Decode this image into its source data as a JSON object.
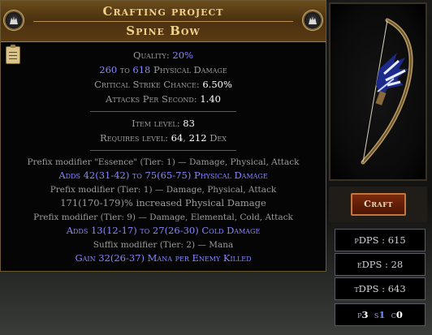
{
  "header": {
    "title": "Crafting project",
    "item_name": "Spine Bow"
  },
  "properties": {
    "quality_label": "Quality:",
    "quality_value": "20%",
    "damage_min": "260",
    "damage_to": "to",
    "damage_max": "618",
    "damage_label": "Physical Damage",
    "crit_label": "Critical Strike Chance:",
    "crit_value": "6.50%",
    "aps_label": "Attacks Per Second:",
    "aps_value": "1.40"
  },
  "requirements": {
    "item_level_label": "Item level:",
    "item_level_value": "83",
    "requires_label": "Requires level:",
    "requires_level": "64",
    "dex_value": "212",
    "dex_label": "Dex"
  },
  "modifiers": [
    {
      "header": "Prefix modifier \"Essence\" (Tier: 1) — Damage, Physical, Attack",
      "text": "Adds 42(31-42) to 75(65-75) Physical Damage",
      "color": "blue"
    },
    {
      "header": "Prefix modifier (Tier: 1) — Damage, Physical, Attack",
      "text": "171(170-179)% increased Physical Damage",
      "color": "grey"
    },
    {
      "header": "Prefix modifier (Tier: 9) — Damage, Elemental, Cold, Attack",
      "text": "Adds 13(12-17) to 27(26-30) Cold Damage",
      "color": "blue"
    },
    {
      "header": "Suffix modifier (Tier: 2) — Mana",
      "text": "Gain 32(26-37) Mana per Enemy Killed",
      "color": "blue"
    }
  ],
  "side": {
    "craft_label": "Craft",
    "pdps_label": "pDPS :",
    "pdps_value": "615",
    "edps_label": "eDPS :",
    "edps_value": "28",
    "tdps_label": "tDPS :",
    "tdps_value": "643",
    "sockets": {
      "p_label": "p",
      "p_value": "3",
      "s_label": "s",
      "s_value": "1",
      "c_label": "c",
      "c_value": "0"
    }
  },
  "colors": {
    "title_gold": "#f0d08a",
    "magic_blue": "#8888ff",
    "craft_button": "#7a2a0c"
  },
  "icons": {
    "corner_left": "wolf-crest-icon",
    "corner_right": "wolf-crest-icon",
    "notes": "clipboard-icon",
    "item": "spine-bow-icon"
  }
}
